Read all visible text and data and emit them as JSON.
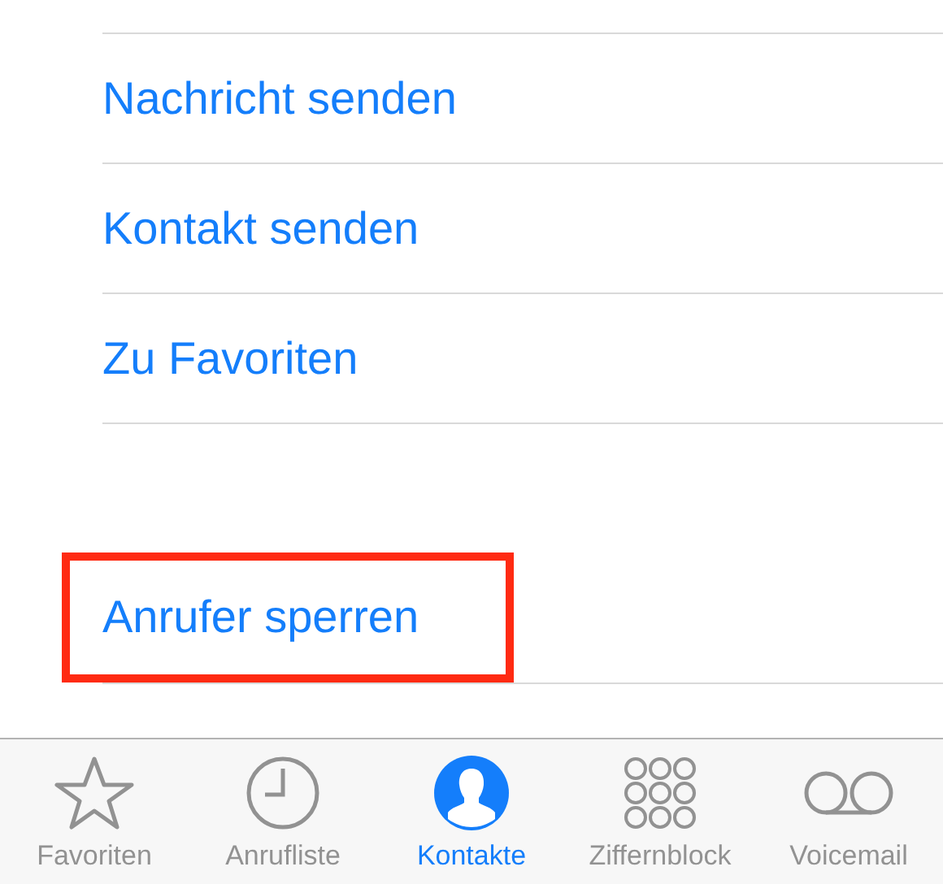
{
  "actions": [
    {
      "label": "Nachricht senden",
      "highlighted": false
    },
    {
      "label": "Kontakt senden",
      "highlighted": false
    },
    {
      "label": "Zu Favoriten",
      "highlighted": false
    }
  ],
  "block_action": {
    "label": "Anrufer sperren",
    "highlighted": true
  },
  "tab_bar": [
    {
      "label": "Favoriten",
      "selected": false
    },
    {
      "label": "Anrufliste",
      "selected": false
    },
    {
      "label": "Kontakte",
      "selected": true
    },
    {
      "label": "Ziffernblock",
      "selected": false
    },
    {
      "label": "Voicemail",
      "selected": false
    }
  ]
}
